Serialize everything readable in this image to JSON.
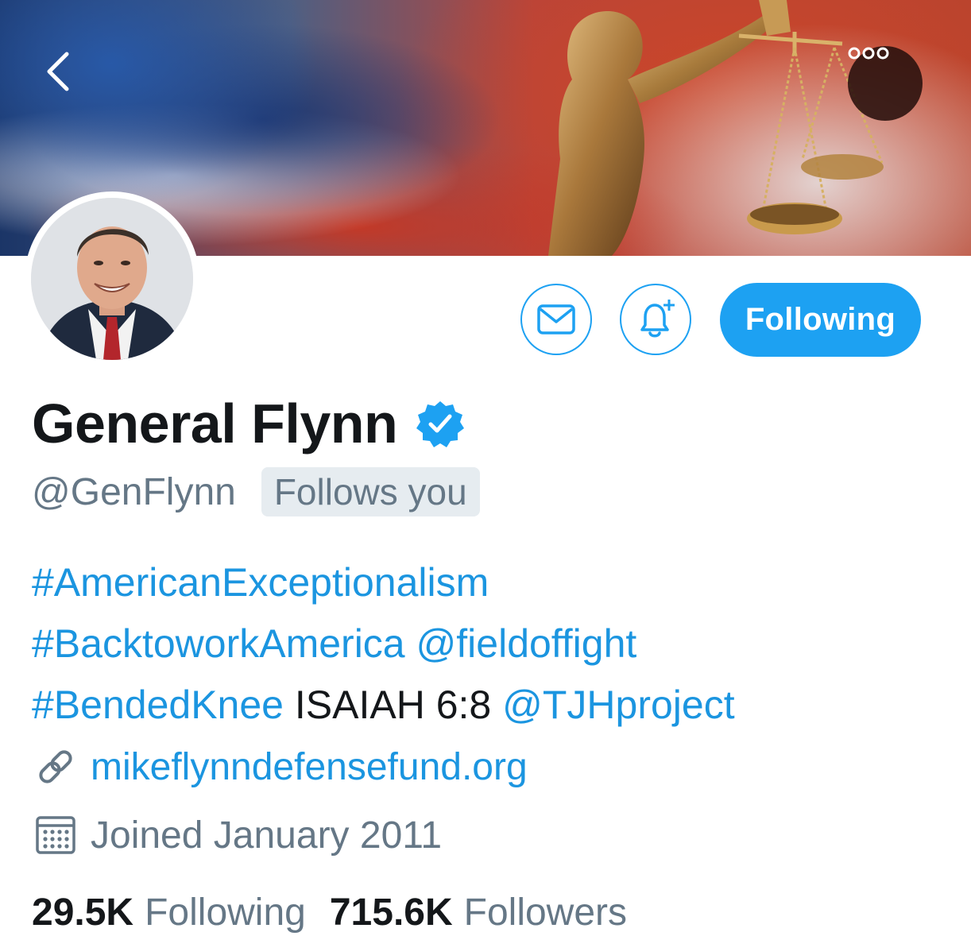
{
  "header": {
    "back_icon": "chevron-left-icon",
    "more_icon": "more-options-icon"
  },
  "actions": {
    "message_icon": "envelope-icon",
    "notify_icon": "bell-plus-icon",
    "following_label": "Following",
    "accent_color": "#1da1f2"
  },
  "profile": {
    "name": "General Flynn",
    "verified_icon": "verified-badge-icon",
    "handle": "@GenFlynn",
    "follows_you": "Follows you"
  },
  "bio": {
    "line1": {
      "tag1": "#AmericanExceptionalism"
    },
    "line2": {
      "tag1": "#BacktoworkAmerica",
      "mention1": "@fieldoffight"
    },
    "line3": {
      "tag1": "#BendedKnee",
      "text1": "ISAIAH 6:8",
      "mention1": "@TJHproject"
    }
  },
  "meta": {
    "url_icon": "link-icon",
    "url": "mikeflynndefensefund.org",
    "joined_icon": "calendar-icon",
    "joined": "Joined January 2011"
  },
  "stats": {
    "following_count": "29.5K",
    "following_label": "Following",
    "followers_count": "715.6K",
    "followers_label": "Followers"
  }
}
